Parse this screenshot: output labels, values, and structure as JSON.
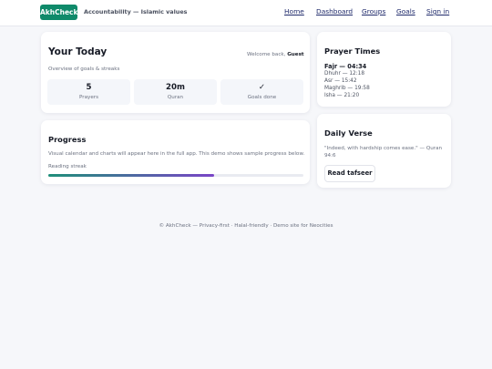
{
  "header": {
    "brand": "AkhCheck",
    "tagline": "Accountability — Islamic values",
    "nav": [
      "Home",
      "Dashboard",
      "Groups",
      "Goals",
      "Sign in"
    ]
  },
  "today": {
    "title": "Your Today",
    "welcome_prefix": "Welcome back,",
    "user": "Guest",
    "subtitle": "Overview of goals & streaks",
    "stats": [
      {
        "value": "5",
        "label": "Prayers"
      },
      {
        "value": "20m",
        "label": "Quran"
      },
      {
        "value": "✓",
        "label": "Goals done"
      }
    ]
  },
  "progress": {
    "title": "Progress",
    "text": "Visual calendar and charts will appear here in the full app. This demo shows sample progress below.",
    "streak_label": "Reading streak",
    "streak_fraction": 0.65
  },
  "prayer": {
    "title": "Prayer Times",
    "times": [
      "Fajr — 04:34",
      "Dhuhr — 12:18",
      "Asr — 15:42",
      "Maghrib — 19:58",
      "Isha — 21:20"
    ]
  },
  "verse": {
    "title": "Daily Verse",
    "text": "\"Indeed, with hardship comes ease.\" — Quran 94:6",
    "button": "Read tafseer"
  },
  "footer": {
    "text": "© AkhCheck — Privacy-first · Halal-friendly · Demo site for Neocities"
  },
  "colors": {
    "brand": "#0f8a6a",
    "accent": "#7a45c7",
    "nav": "#1f2a6b"
  }
}
